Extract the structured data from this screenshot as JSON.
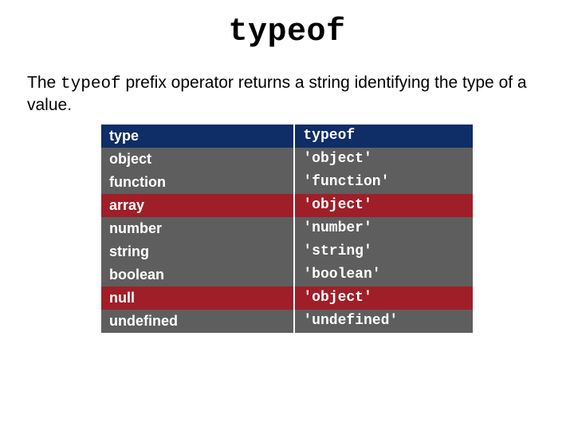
{
  "title": "typeof",
  "description_pre": "The ",
  "description_code": "typeof",
  "description_post": " prefix operator returns a string identifying the type of a value.",
  "table": {
    "headers": {
      "type": "type",
      "typeof": "typeof"
    },
    "rows": [
      {
        "kind": "gray",
        "type": "object",
        "typeof": "'object'"
      },
      {
        "kind": "gray",
        "type": "function",
        "typeof": "'function'"
      },
      {
        "kind": "red",
        "type": "array",
        "typeof": "'object'"
      },
      {
        "kind": "gray",
        "type": "number",
        "typeof": "'number'"
      },
      {
        "kind": "gray",
        "type": "string",
        "typeof": "'string'"
      },
      {
        "kind": "gray",
        "type": "boolean",
        "typeof": "'boolean'"
      },
      {
        "kind": "red",
        "type": "null",
        "typeof": "'object'"
      },
      {
        "kind": "gray",
        "type": "undefined",
        "typeof": "'undefined'"
      }
    ]
  }
}
